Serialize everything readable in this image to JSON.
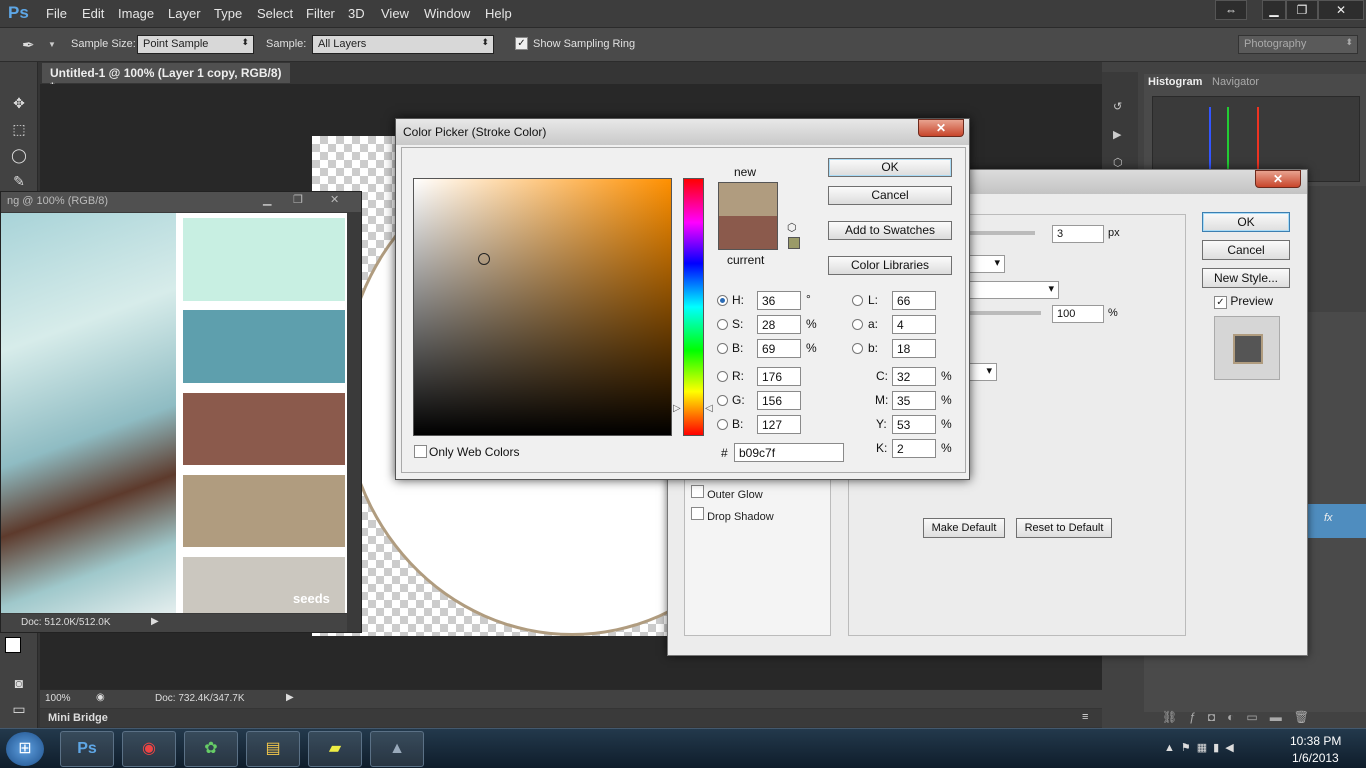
{
  "app": {
    "logo": "Ps"
  },
  "menu": [
    "File",
    "Edit",
    "Image",
    "Layer",
    "Type",
    "Select",
    "Filter",
    "3D",
    "View",
    "Window",
    "Help"
  ],
  "options": {
    "sample_size_label": "Sample Size:",
    "sample_size_value": "Point Sample",
    "sample_label": "Sample:",
    "sample_value": "All Layers",
    "show_ring_label": "Show Sampling Ring",
    "workspace": "Photography"
  },
  "document": {
    "tab_title": "Untitled-1 @ 100% (Layer 1 copy, RGB/8) *",
    "zoom": "100%",
    "doc_size": "Doc: 732.4K/347.7K"
  },
  "float_doc": {
    "title": "ng @ 100% (RGB/8)",
    "doc_size": "Doc: 512.0K/512.0K",
    "brand": "seeds",
    "swatches": [
      "#c8efe2",
      "#5e9fad",
      "#8b5a4c",
      "#b09c7f",
      "#cbc7bf"
    ]
  },
  "mini_bridge": "Mini Bridge",
  "right_panel": {
    "tabs": [
      "Histogram",
      "Navigator"
    ]
  },
  "layer_style": {
    "ok": "OK",
    "cancel": "Cancel",
    "new_style": "New Style...",
    "preview": "Preview",
    "size_value": "3",
    "size_unit": "px",
    "opacity_value": "100",
    "opacity_unit": "%",
    "effects": [
      "Outer Glow",
      "Drop Shadow"
    ],
    "make_default": "Make Default",
    "reset_default": "Reset to Default"
  },
  "color_picker": {
    "title": "Color Picker (Stroke Color)",
    "ok": "OK",
    "cancel": "Cancel",
    "add_swatches": "Add to Swatches",
    "color_libraries": "Color Libraries",
    "new_label": "new",
    "current_label": "current",
    "new_color": "#b09c7f",
    "current_color": "#8b5a4c",
    "only_web": "Only Web Colors",
    "hsb": {
      "H": "36",
      "S": "28",
      "B": "69",
      "H_unit": "°",
      "S_unit": "%",
      "B_unit": "%"
    },
    "rgb": {
      "R": "176",
      "G": "156",
      "B": "127"
    },
    "lab": {
      "L": "66",
      "a": "4",
      "b": "18"
    },
    "cmyk": {
      "C": "32",
      "M": "35",
      "Y": "53",
      "K": "2",
      "unit": "%"
    },
    "hex": "b09c7f"
  },
  "taskbar": {
    "time": "10:38 PM",
    "date": "1/6/2013"
  }
}
